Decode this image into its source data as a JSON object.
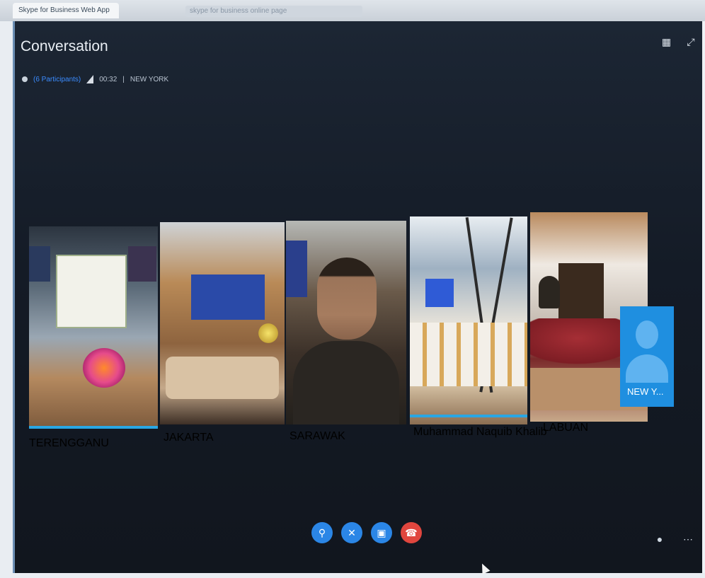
{
  "browser": {
    "tab_title": "Skype for Business Web App",
    "url": "skype for business online page"
  },
  "conversation": {
    "title": "Conversation",
    "participants": "(6 Participants)",
    "duration": "00:32",
    "separator": "|",
    "location": "NEW YORK"
  },
  "top_icons": [
    "layout-icon",
    "fullscreen-icon"
  ],
  "tiles": [
    {
      "name": "TERENGGANU"
    },
    {
      "name": "JAKARTA"
    },
    {
      "name": "SARAWAK"
    },
    {
      "name": "Muhammad Naquib Khalib"
    },
    {
      "name": "LABUAN"
    }
  ],
  "avatar": {
    "name": "NEW Y..."
  },
  "controls": {
    "mic": "microphone-off-icon",
    "video": "video-off-icon",
    "present": "present-screen-icon",
    "hangup": "hang-up-icon"
  },
  "bottom_right": [
    "participants-icon",
    "more-options-icon"
  ],
  "colors": {
    "accent": "#2b86e6",
    "hangup": "#e0463e",
    "avatar_bg": "#1f8fe0"
  }
}
